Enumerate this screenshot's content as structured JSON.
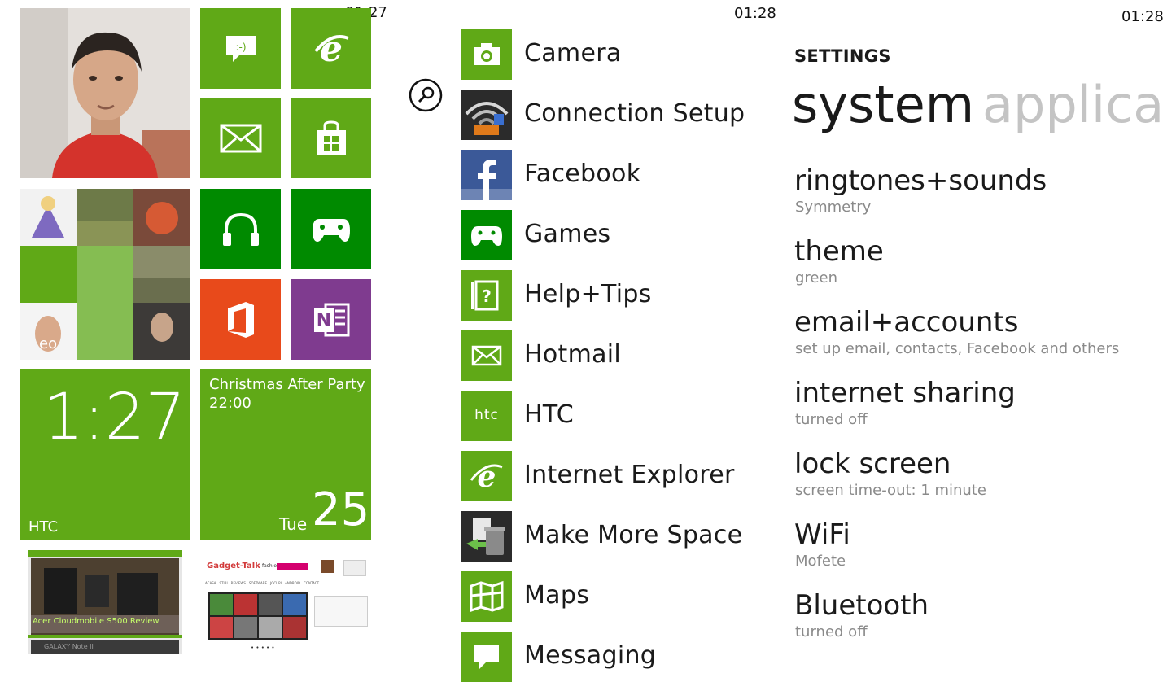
{
  "status": {
    "clock1": "01:27",
    "clock2": "01:28",
    "clock3": "01:28"
  },
  "colors": {
    "accent": "#60a917",
    "dark_green": "#008a00",
    "office_orange": "#e84a1b",
    "onenote_purple": "#7f3b8f"
  },
  "start": {
    "clock_tile": {
      "time": "1:27",
      "label": "HTC"
    },
    "calendar_tile": {
      "event": "Christmas After Party",
      "time": "22:00",
      "day": "Tue",
      "date": "25"
    },
    "people_tile_text": "eo",
    "review_tile_caption": "Acer Cloudmobile S500 Review",
    "review_tile_lower_caption": "GALAXY Note II",
    "site_tile": {
      "logo": "Gadget-Talk",
      "logo_sub": "fashion days",
      "nav": [
        "ACASA",
        "STIRI",
        "REVIEWS",
        "SOFTWARE",
        "JOCURI",
        "ANDROID",
        "CONTACT"
      ],
      "pagination": "• • • • •"
    },
    "tiles": [
      {
        "name": "messaging",
        "icon": "messaging-icon"
      },
      {
        "name": "internet-explorer",
        "icon": "ie-icon"
      },
      {
        "name": "mail",
        "icon": "mail-icon"
      },
      {
        "name": "store",
        "icon": "store-icon"
      },
      {
        "name": "music",
        "icon": "headphones-icon"
      },
      {
        "name": "games",
        "icon": "xbox-controller-icon"
      },
      {
        "name": "office",
        "icon": "office-icon"
      },
      {
        "name": "onenote",
        "icon": "onenote-icon"
      }
    ]
  },
  "apps": {
    "search_icon": "search-icon",
    "items": [
      {
        "label": "Camera",
        "icon": "camera-icon"
      },
      {
        "label": "Connection Setup",
        "icon": "wireless-icon"
      },
      {
        "label": "Facebook",
        "icon": "facebook-icon"
      },
      {
        "label": "Games",
        "icon": "xbox-controller-icon"
      },
      {
        "label": "Help+Tips",
        "icon": "help-icon"
      },
      {
        "label": "Hotmail",
        "icon": "mail-icon"
      },
      {
        "label": "HTC",
        "icon": "htc-icon",
        "icon_text": "htc"
      },
      {
        "label": "Internet Explorer",
        "icon": "ie-icon"
      },
      {
        "label": "Make More Space",
        "icon": "trash-icon"
      },
      {
        "label": "Maps",
        "icon": "map-icon"
      },
      {
        "label": "Messaging",
        "icon": "messaging-icon"
      }
    ]
  },
  "settings": {
    "header": "SETTINGS",
    "pivot_active": "system",
    "pivot_next": "applica",
    "items": [
      {
        "name": "ringtones+sounds",
        "value": "Symmetry"
      },
      {
        "name": "theme",
        "value": "green"
      },
      {
        "name": "email+accounts",
        "value": "set up email, contacts, Facebook and others"
      },
      {
        "name": "internet sharing",
        "value": "turned off"
      },
      {
        "name": "lock screen",
        "value": "screen time-out: 1 minute"
      },
      {
        "name": "WiFi",
        "value": "Mofete"
      },
      {
        "name": "Bluetooth",
        "value": "turned off"
      }
    ]
  }
}
